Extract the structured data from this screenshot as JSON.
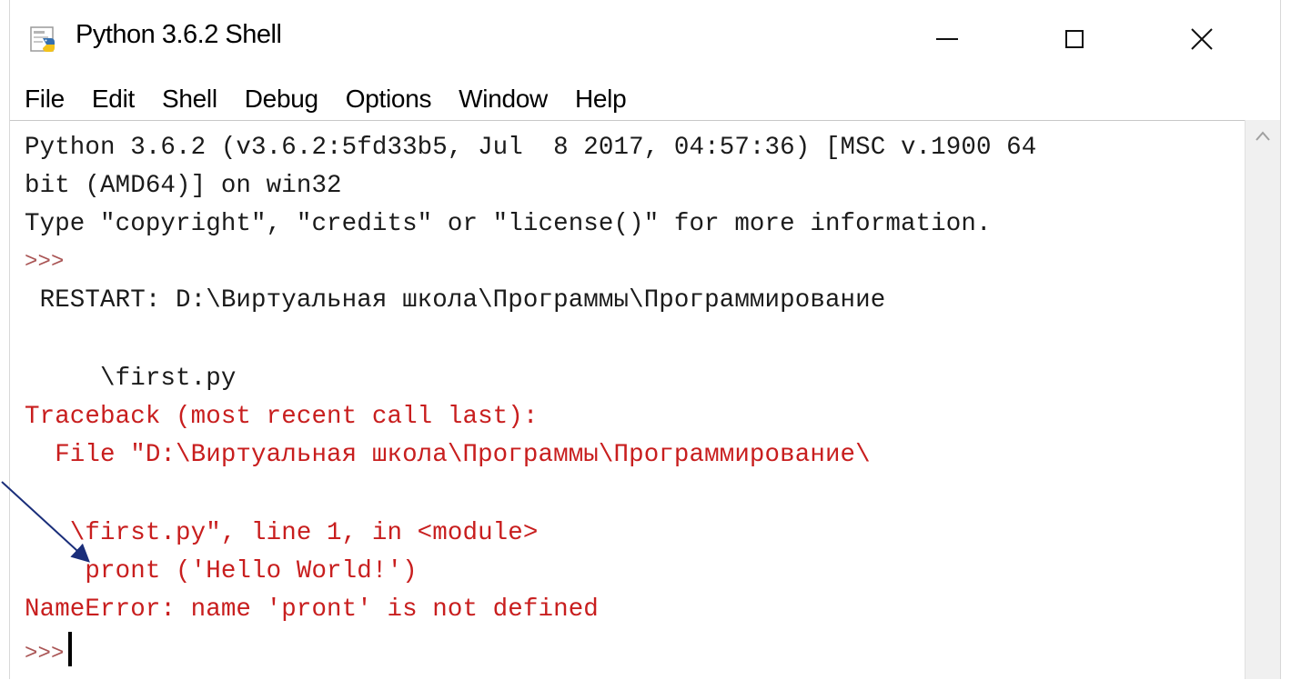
{
  "window": {
    "title": "Python 3.6.2 Shell",
    "icon": "python-idle-icon",
    "controls": [
      "minimize-icon",
      "maximize-icon",
      "close-icon"
    ],
    "close_glyph": "✕"
  },
  "menu": [
    "File",
    "Edit",
    "Shell",
    "Debug",
    "Options",
    "Window",
    "Help"
  ],
  "shell": {
    "lines": [
      {
        "text": "Python 3.6.2 (v3.6.2:5fd33b5, Jul  8 2017, 04:57:36) [MSC v.1900 64",
        "color": "black"
      },
      {
        "text": "bit (AMD64)] on win32",
        "color": "black"
      },
      {
        "text": "Type \"copyright\", \"credits\" or \"license()\" for more information.",
        "color": "black"
      },
      {
        "text": ">>>",
        "color": "prompt"
      },
      {
        "text": " RESTART: D:\\Виртуальная школа\\Программы\\Программирование",
        "color": "black"
      },
      {
        "text": "",
        "color": "black"
      },
      {
        "text": "     \\first.py",
        "color": "black"
      },
      {
        "text": "Traceback (most recent call last):",
        "color": "red"
      },
      {
        "text": "  File \"D:\\Виртуальная школа\\Программы\\Программирование\\",
        "color": "red"
      },
      {
        "text": "",
        "color": "red"
      },
      {
        "text": "   \\first.py\", line 1, in <module>",
        "color": "red"
      },
      {
        "text": "    pront ('Hello World!')",
        "color": "red"
      },
      {
        "text": "NameError: name 'pront' is not defined",
        "color": "red"
      },
      {
        "text": ">>>",
        "color": "prompt"
      }
    ]
  },
  "colors": {
    "error_text": "#c81e1e",
    "normal_text": "#1b1b1b",
    "prompt": "#aa5555",
    "annotation_arrow": "#1a2e7a"
  }
}
